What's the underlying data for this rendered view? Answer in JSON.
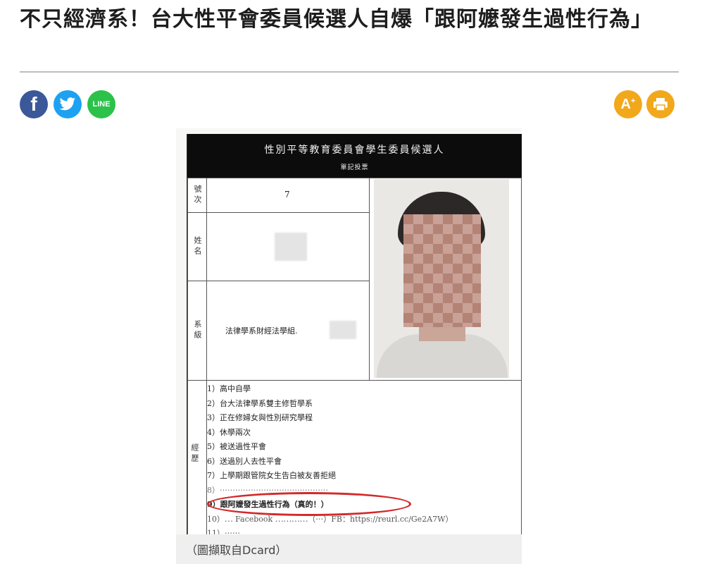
{
  "article": {
    "headline": "不只經濟系！台大性平會委員候選人自爆「跟阿嬤發生過性行為」"
  },
  "share": {
    "facebook_glyph": "f",
    "line_label": "LINE"
  },
  "tools": {
    "font_size_glyph": "A",
    "font_size_sup": "+"
  },
  "colors": {
    "facebook": "#3b5998",
    "twitter": "#1da1f2",
    "line": "#2bc24a",
    "tool_gold": "#f2a81b",
    "highlight_circle": "#d32a2a"
  },
  "sheet": {
    "title": "性別平等教育委員會學生委員候選人",
    "subtitle": "單記投票",
    "labels": {
      "number": "號次",
      "name": "姓名",
      "department": "系級",
      "experience": "經歷"
    },
    "number_value": "7",
    "department_value": "法律學系財經法學組."
  },
  "bio": [
    "1）高中自學",
    "2）台大法律學系雙主修哲學系",
    "3）正在修婦女與性別研究學程",
    "4）休學兩次",
    "5）被送過性平會",
    "6）送過別人去性平會",
    "7）上學期跟管院女生告白被友善拒絕",
    "8）⋯⋯⋯⋯⋯⋯⋯⋯⋯⋯⋯⋯⋯⋯",
    "9）跟阿嬤發生過性行為（真的！）",
    "10）⋯ Facebook ⋯⋯⋯⋯（⋯）FB：https://reurl.cc/Ge2A7W）",
    "11）⋯⋯"
  ],
  "caption": "（圖擷取自Dcard）"
}
